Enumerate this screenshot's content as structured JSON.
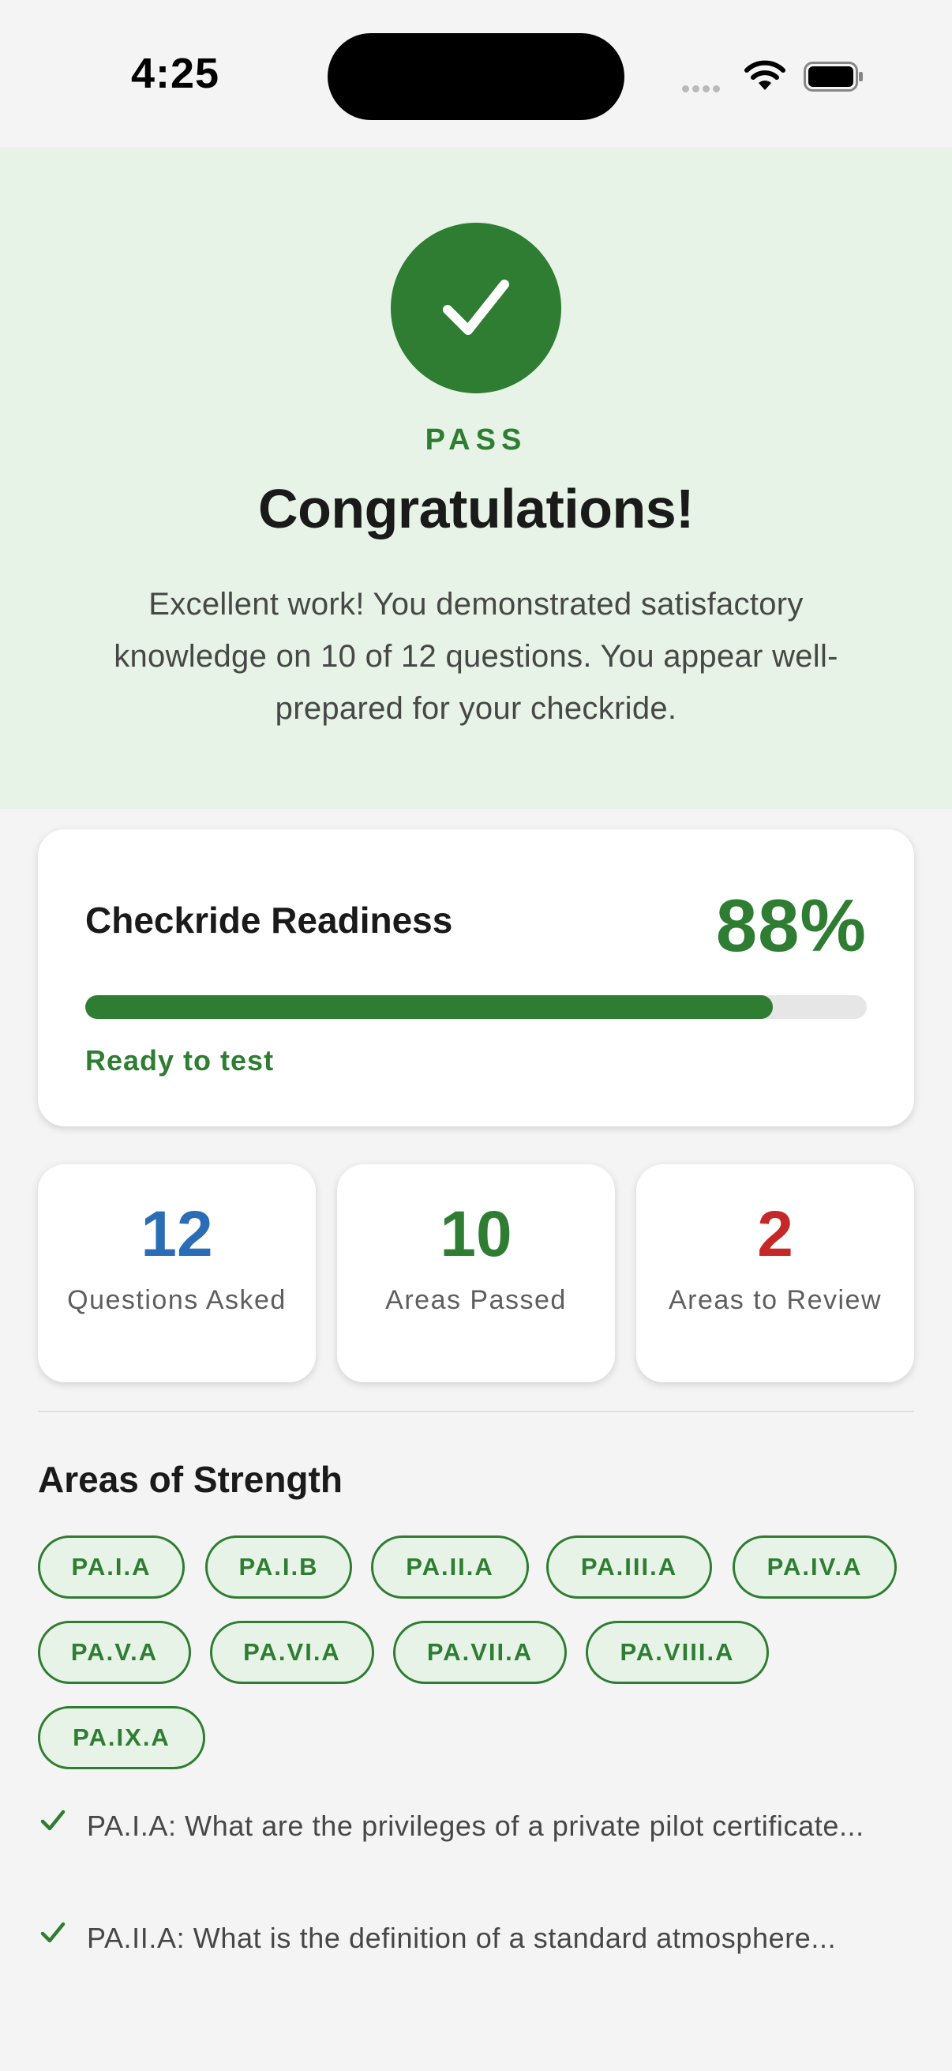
{
  "status_bar": {
    "time": "4:25"
  },
  "hero": {
    "pass_label": "PASS",
    "title": "Congratulations!",
    "message": "Excellent work! You demonstrated satisfactory knowledge on 10 of 12 questions. You appear well-prepared for your checkride."
  },
  "readiness": {
    "title": "Checkride Readiness",
    "percent_text": "88%",
    "progress": 0.88,
    "status": "Ready to test"
  },
  "stats": [
    {
      "value": "12",
      "label": "Questions Asked",
      "color": "#2a6db5"
    },
    {
      "value": "10",
      "label": "Areas Passed",
      "color": "#2e7d32"
    },
    {
      "value": "2",
      "label": "Areas to Review",
      "color": "#c62828"
    }
  ],
  "strengths": {
    "title": "Areas of Strength",
    "tags": [
      "PA.I.A",
      "PA.I.B",
      "PA.II.A",
      "PA.III.A",
      "PA.IV.A",
      "PA.V.A",
      "PA.VI.A",
      "PA.VII.A",
      "PA.VIII.A",
      "PA.IX.A"
    ],
    "items": [
      "PA.I.A: What are the privileges of a private pilot certificate...",
      "PA.II.A: What is the definition of a standard atmosphere..."
    ]
  },
  "colors": {
    "accent": "#2e7d32",
    "hero_bg": "#e6f3e6",
    "page_bg": "#f4f4f4"
  },
  "icons": {
    "hero": "checkmark-icon",
    "list": "checkmark-icon"
  }
}
